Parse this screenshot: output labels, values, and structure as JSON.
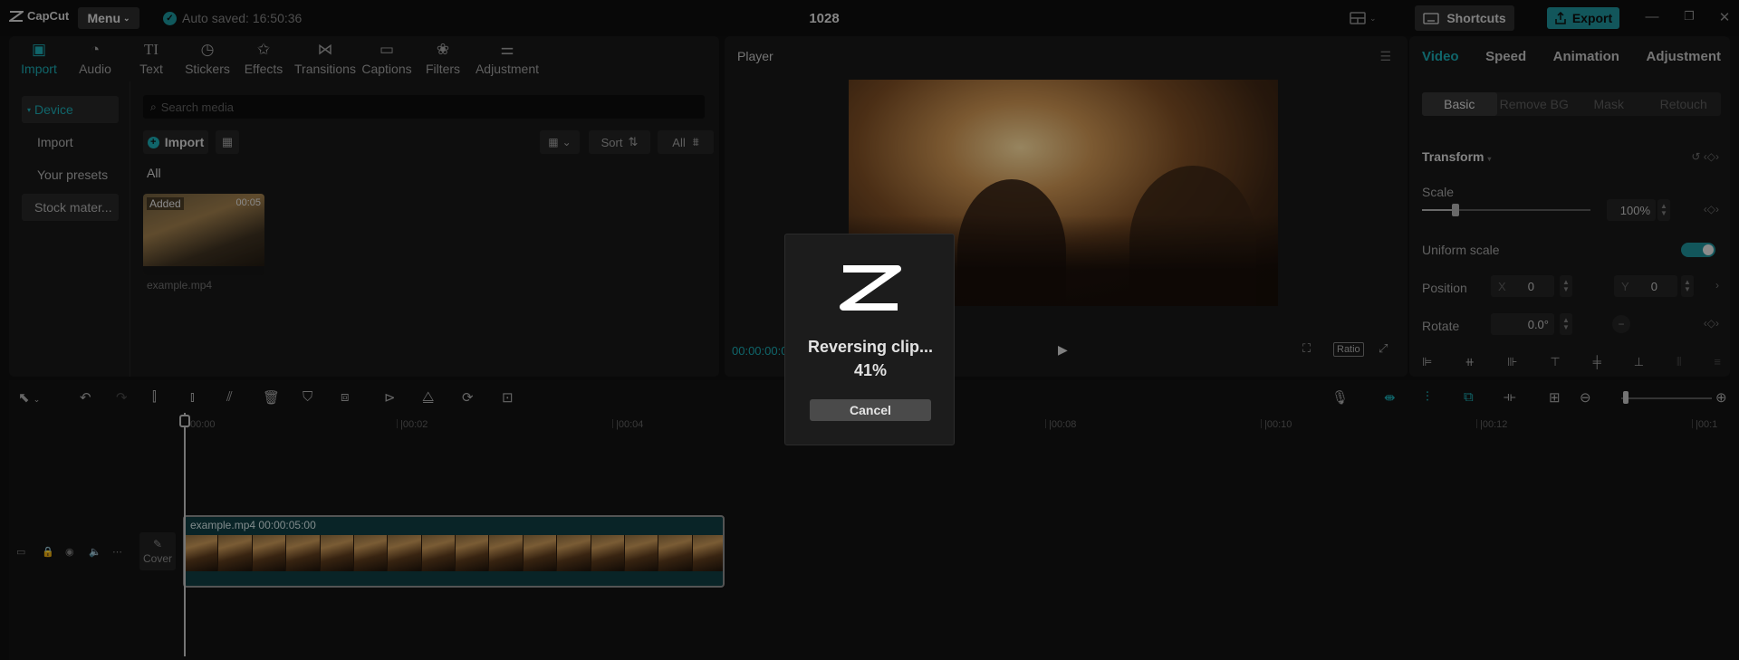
{
  "app": {
    "logo_text": "CapCut",
    "menu_label": "Menu",
    "autosave": "Auto saved: 16:50:36",
    "project_title": "1028",
    "shortcuts_label": "Shortcuts",
    "export_label": "Export"
  },
  "toolbar": {
    "tabs": [
      {
        "label": "Import",
        "icon": "import-icon"
      },
      {
        "label": "Audio",
        "icon": "audio-icon"
      },
      {
        "label": "Text",
        "icon": "text-icon"
      },
      {
        "label": "Stickers",
        "icon": "stickers-icon"
      },
      {
        "label": "Effects",
        "icon": "effects-icon"
      },
      {
        "label": "Transitions",
        "icon": "transitions-icon"
      },
      {
        "label": "Captions",
        "icon": "captions-icon"
      },
      {
        "label": "Filters",
        "icon": "filters-icon"
      },
      {
        "label": "Adjustment",
        "icon": "adjustment-icon"
      }
    ]
  },
  "sidebar": {
    "items": [
      {
        "label": "Device"
      },
      {
        "label": "Import"
      },
      {
        "label": "Your presets"
      },
      {
        "label": "Stock mater..."
      }
    ]
  },
  "media": {
    "search_placeholder": "Search media",
    "import_label": "Import",
    "sort_label": "Sort",
    "filter_label": "All",
    "section_label": "All",
    "items": [
      {
        "name": "example.mp4",
        "badge": "Added",
        "duration": "00:05"
      }
    ]
  },
  "player": {
    "title": "Player",
    "timecode": "00:00:00:00",
    "ratio_label": "Ratio"
  },
  "inspector": {
    "tabs": [
      "Video",
      "Speed",
      "Animation",
      "Adjustment"
    ],
    "subtabs": [
      "Basic",
      "Remove BG",
      "Mask",
      "Retouch"
    ],
    "transform_label": "Transform",
    "scale_label": "Scale",
    "scale_value": "100%",
    "scale_level": 0.2,
    "uniform_scale_label": "Uniform scale",
    "uniform_scale_on": true,
    "position_label": "Position",
    "x_label": "X",
    "x_value": "0",
    "y_label": "Y",
    "y_value": "0",
    "rotate_label": "Rotate",
    "rotate_value": "0.0°"
  },
  "timeline": {
    "ruler": [
      "00:00",
      "|00:02",
      "|00:04",
      "|00:08",
      "|00:10",
      "|00:12",
      "|00:1"
    ],
    "cover_label": "Cover",
    "clip": {
      "name": "example.mp4",
      "duration": "00:00:05:00"
    }
  },
  "modal": {
    "message": "Reversing clip...",
    "progress": "41%",
    "progress_value": 0.41,
    "cancel_label": "Cancel"
  },
  "colors": {
    "accent": "#1aa3ab",
    "background": "#101010",
    "panel": "#171717"
  }
}
